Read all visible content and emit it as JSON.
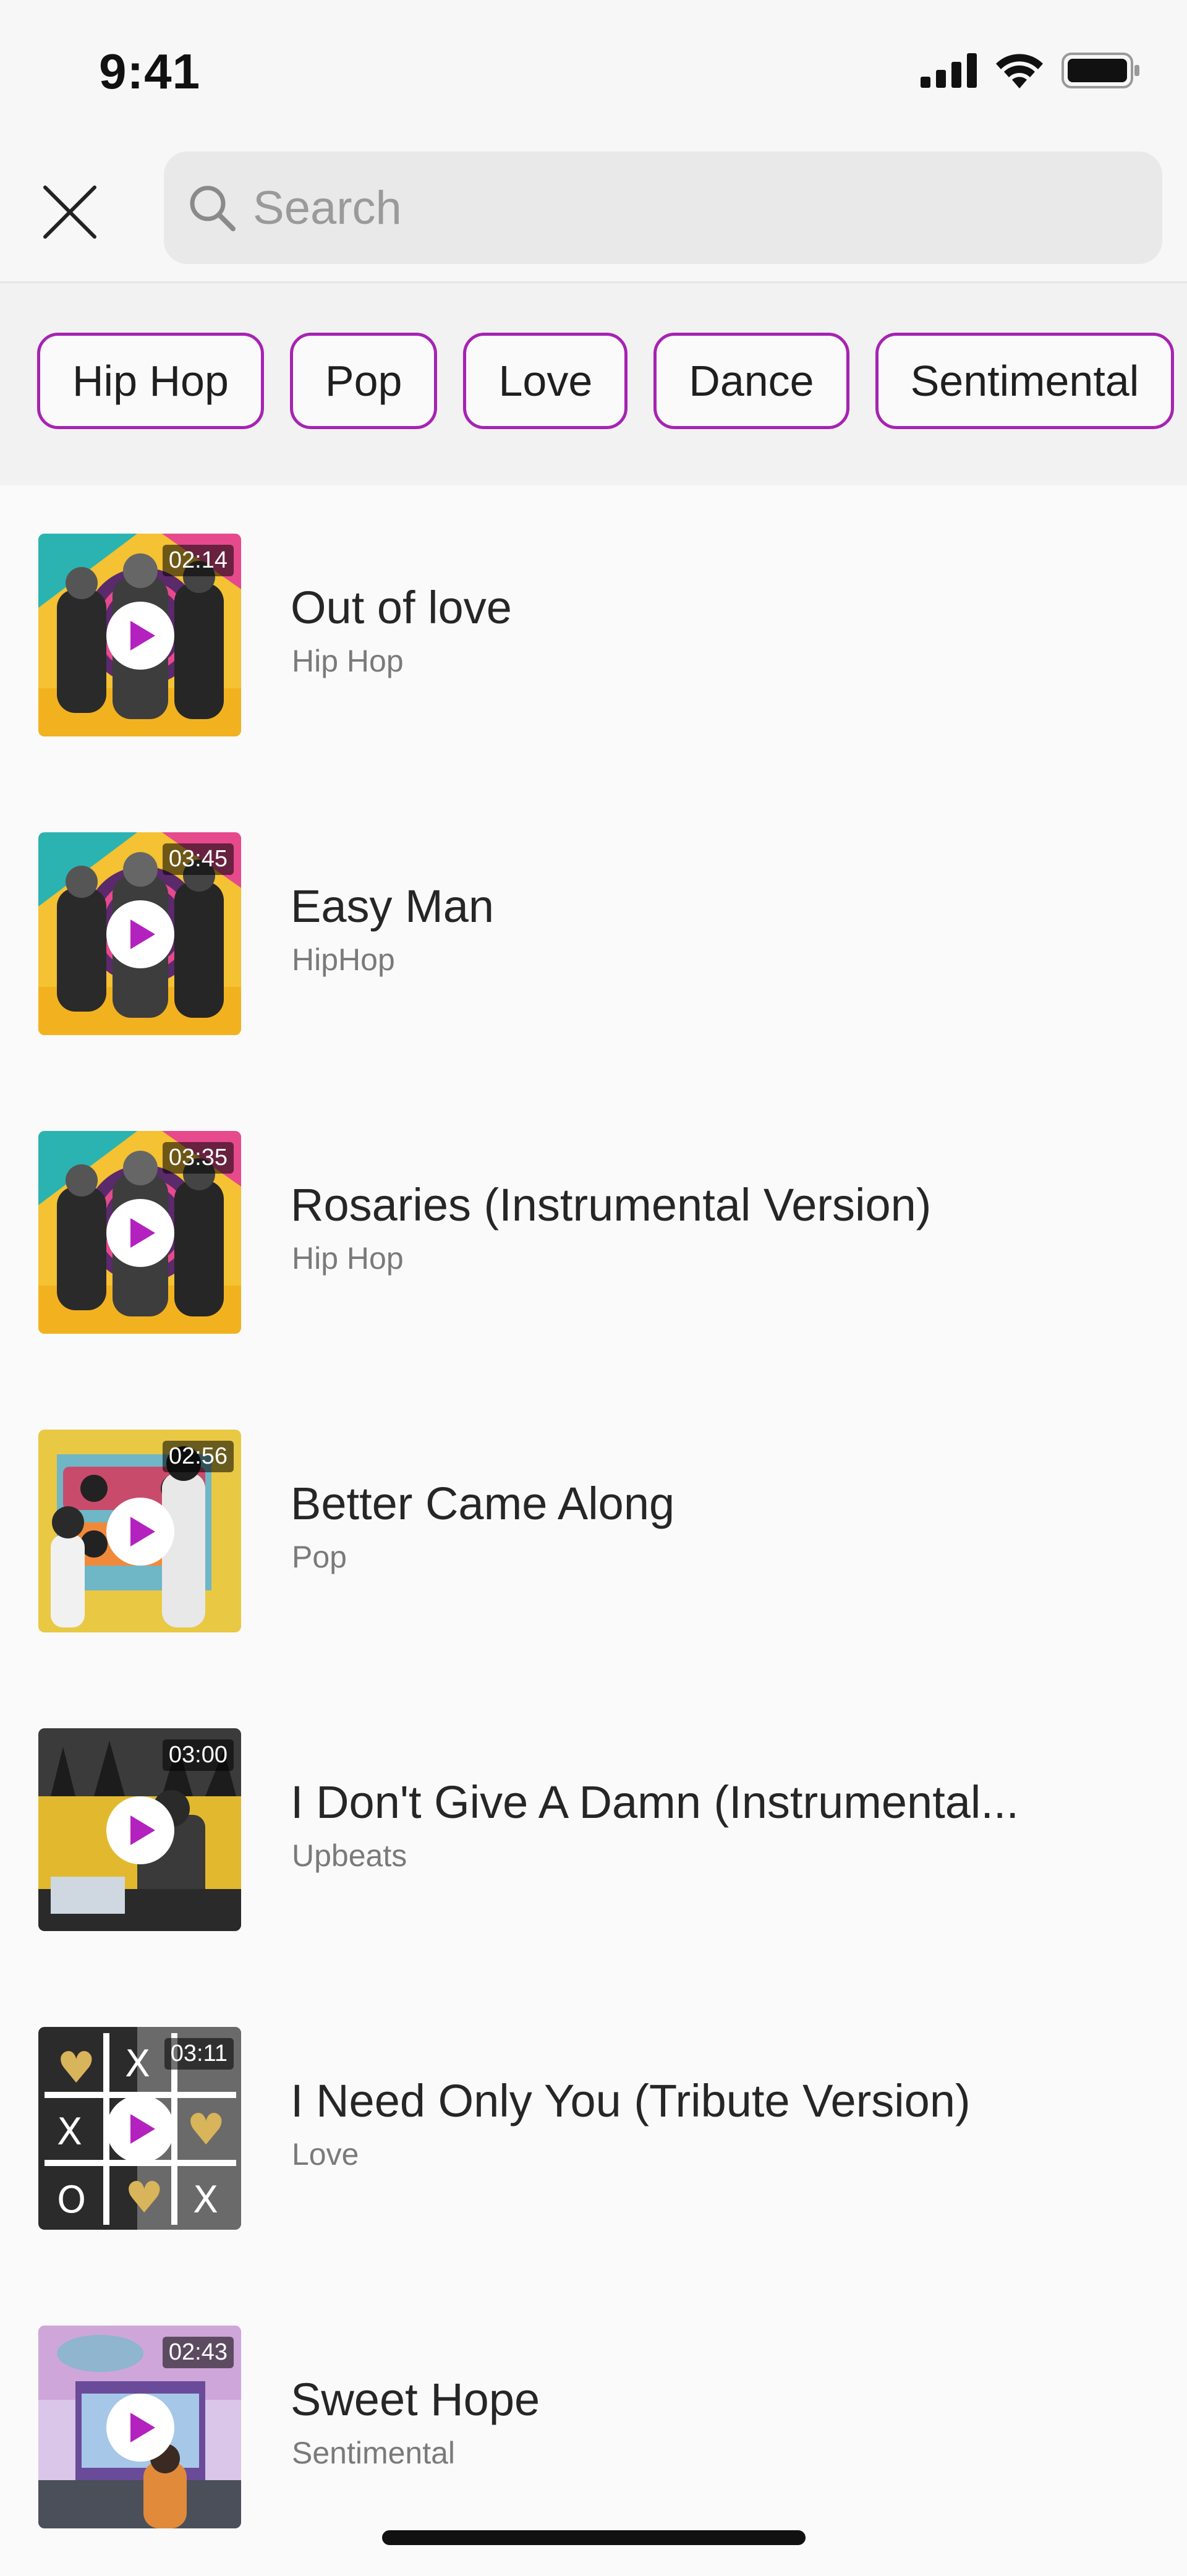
{
  "status_bar": {
    "time": "9:41"
  },
  "search": {
    "placeholder": "Search",
    "value": ""
  },
  "chips": [
    "Hip Hop",
    "Pop",
    "Love",
    "Dance",
    "Sentimental"
  ],
  "colors": {
    "accent": "#a722b3",
    "background": "#fafafa"
  },
  "tracks": [
    {
      "title": "Out of love",
      "genre": "Hip Hop",
      "duration": "02:14",
      "art": "hiphop"
    },
    {
      "title": "Easy Man",
      "genre": "HipHop",
      "duration": "03:45",
      "art": "hiphop"
    },
    {
      "title": "Rosaries (Instrumental Version)",
      "genre": "Hip Hop",
      "duration": "03:35",
      "art": "hiphop"
    },
    {
      "title": "Better Came Along",
      "genre": "Pop",
      "duration": "02:56",
      "art": "pop"
    },
    {
      "title": "I Don't Give A Damn (Instrumental...",
      "genre": "Upbeats",
      "duration": "03:00",
      "art": "dj"
    },
    {
      "title": "I Need Only You (Tribute Version)",
      "genre": "Love",
      "duration": "03:11",
      "art": "love"
    },
    {
      "title": "Sweet Hope",
      "genre": "Sentimental",
      "duration": "02:43",
      "art": "sentimental"
    }
  ]
}
